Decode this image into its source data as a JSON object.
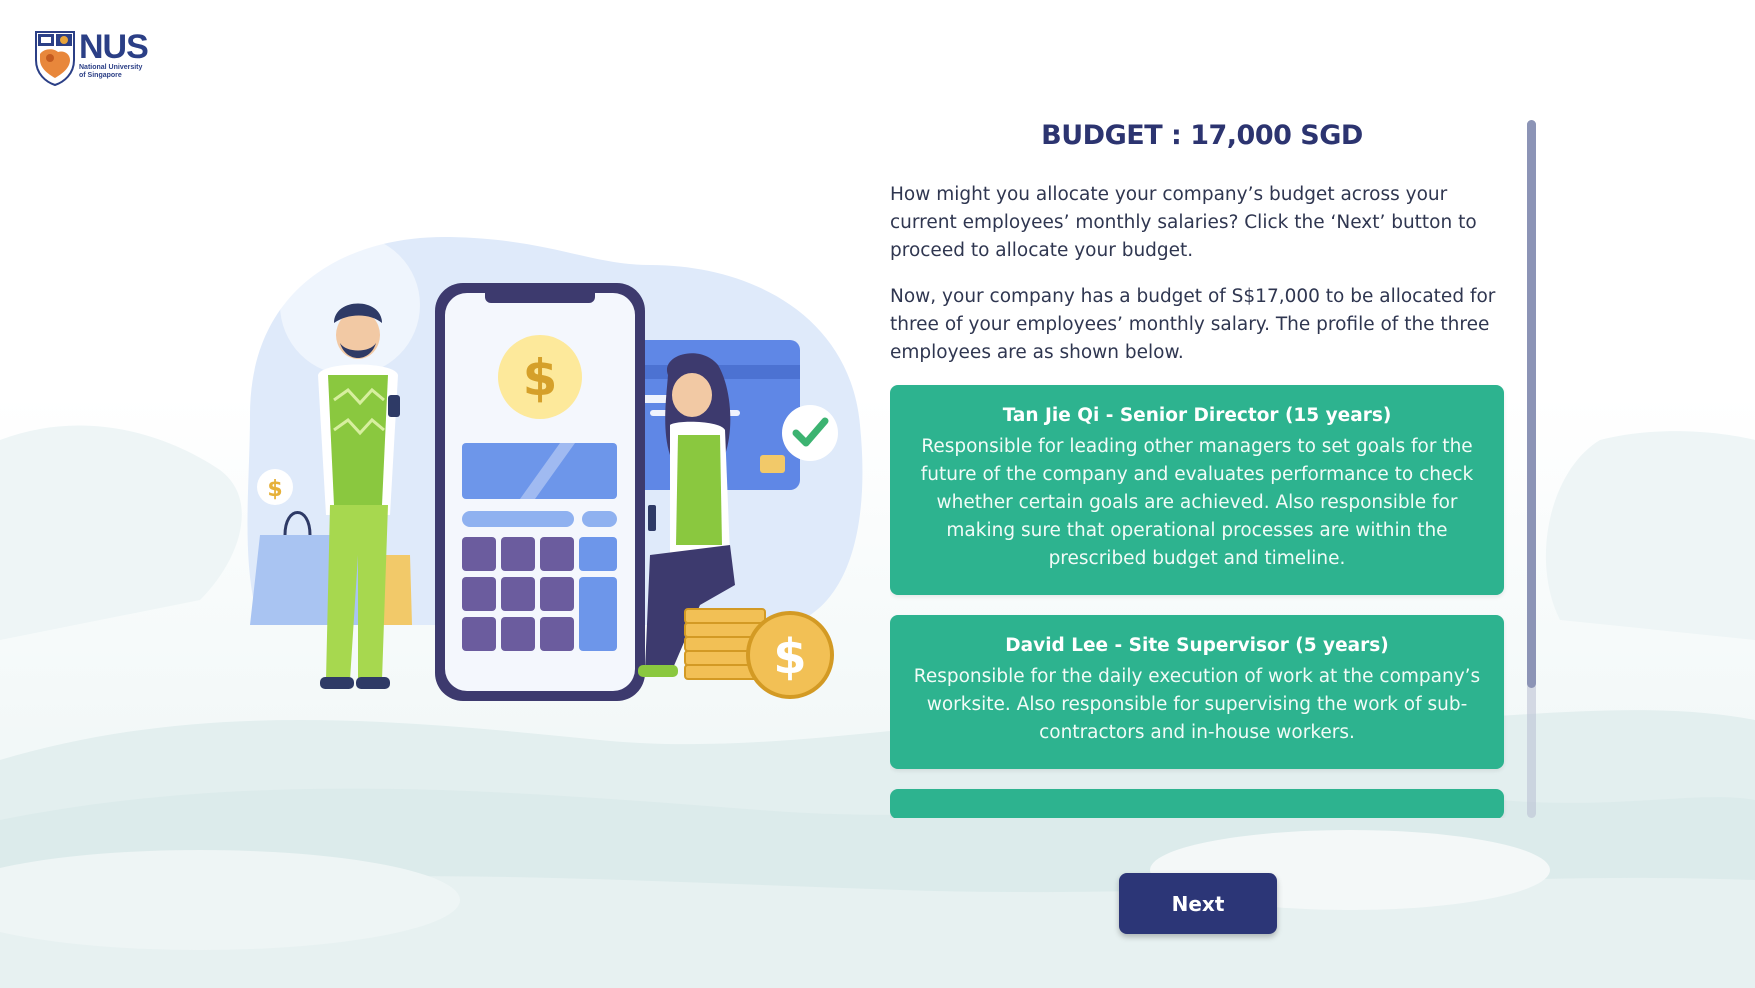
{
  "logo": {
    "name": "NUS",
    "subtitle_line1": "National University",
    "subtitle_line2": "of Singapore"
  },
  "panel": {
    "title": "BUDGET : 17,000 SGD",
    "paragraphs": [
      "How might you allocate your company’s budget across your current employees’ monthly salaries? Click the ‘Next’ button to proceed to allocate your budget.",
      "Now, your company has a budget of S$17,000 to be allocated for three of your employees’ monthly salary. The profile of the three employees are as shown below."
    ],
    "employees": [
      {
        "name": "Tan Jie Qi - Senior Director (15 years)",
        "description": "Responsible for leading other managers to set goals for the future of the company and evaluates performance to check whether certain goals are achieved. Also responsible for making sure that operational processes are within the prescribed budget and timeline."
      },
      {
        "name": "David Lee - Site Supervisor (5 years)",
        "description": "Responsible for the daily execution of work at the company’s worksite. Also responsible for supervising the work of sub-contractors and in-house workers."
      }
    ]
  },
  "next_button": {
    "label": "Next"
  },
  "colors": {
    "accent": "#2db38f",
    "primary": "#2c3677",
    "text": "#2f3650"
  },
  "icons": [
    "nus-crest-icon",
    "dollar-coin-icon",
    "checkmark-icon",
    "credit-card-icon",
    "smartphone-icon"
  ]
}
